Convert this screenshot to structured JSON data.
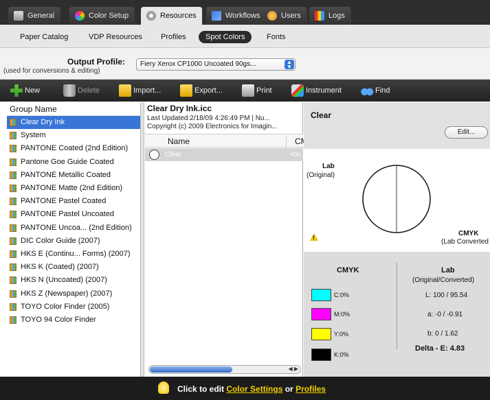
{
  "top_tabs": [
    {
      "label": "General",
      "active": false,
      "icon": "printer-icon"
    },
    {
      "label": "Color Setup",
      "active": false,
      "icon": "color-wheel-icon"
    },
    {
      "label": "Resources",
      "active": true,
      "icon": "gear-icon"
    },
    {
      "label": "Workflows",
      "active": false,
      "icon": "workflow-icon"
    },
    {
      "label": "Users",
      "active": false,
      "icon": "users-icon"
    },
    {
      "label": "Logs",
      "active": false,
      "icon": "logs-icon"
    }
  ],
  "sub_tabs": [
    {
      "label": "Paper Catalog",
      "active": false
    },
    {
      "label": "VDP Resources",
      "active": false
    },
    {
      "label": "Profiles",
      "active": false
    },
    {
      "label": "Spot Colors",
      "active": true
    },
    {
      "label": "Fonts",
      "active": false
    }
  ],
  "output_profile": {
    "label": "Output Profile:",
    "sublabel": "(used for conversions & editing)",
    "value": "Fiery Xerox CP1000 Uncoated 90gs..."
  },
  "toolbar": {
    "new": "New",
    "delete": "Delete",
    "import": "Import...",
    "export": "Export...",
    "print": "Print",
    "instrument": "Instrument",
    "find": "Find"
  },
  "groups": {
    "header": "Group Name",
    "items": [
      "Clear Dry Ink",
      "System",
      "PANTONE Coated (2nd Edition)",
      "Pantone Goe Guide Coated",
      "PANTONE Metallic Coated",
      "PANTONE Matte (2nd Edition)",
      "PANTONE Pastel Coated",
      "PANTONE Pastel Uncoated",
      "PANTONE Uncoa... (2nd Edition)",
      "DIC Color Guide (2007)",
      "HKS E (Continu... Forms) (2007)",
      "HKS K (Coated) (2007)",
      "HKS N (Uncoated) (2007)",
      "HKS Z (Newspaper) (2007)",
      "TOYO Color Finder (2005)",
      "TOYO 94 Color Finder"
    ],
    "selected": 0
  },
  "file": {
    "title": "Clear Dry Ink.icc",
    "updated": "Last Updated:2/18/09 4:26:49 PM | Nu...",
    "copyright": "Copyright (c) 2009 Electronics for Imagin...",
    "col_name": "Name",
    "col_cmyk": "CM",
    "row_name": "Clear",
    "row_cmyk": "<0c"
  },
  "detail": {
    "color_name": "Clear",
    "edit_label": "Edit...",
    "lab_title": "Lab",
    "lab_sub": "(Original)",
    "cmyk_title": "CMYK",
    "cmyk_sub": "(Lab Converted",
    "values_cmyk_header": "CMYK",
    "values_lab_header": "Lab",
    "values_lab_sub": "(Original/Converted)",
    "c": "C:0%",
    "m": "M:0%",
    "y": "Y:0%",
    "k": "K:0%",
    "l": "L:  100 / 95.54",
    "a": "a:  -0 / -0.91",
    "b": "b:  0 / 1.62",
    "delta": "Delta - E:  4.83"
  },
  "status": {
    "prefix": "Click to edit",
    "link1": "Color Settings",
    "middle": "or",
    "link2": "Profiles"
  },
  "colors": {
    "selected": "#3875d7",
    "cyan": "#00ffff",
    "magenta": "#ff00ff",
    "yellow": "#ffff00",
    "black": "#000000",
    "link": "#f0d000"
  }
}
